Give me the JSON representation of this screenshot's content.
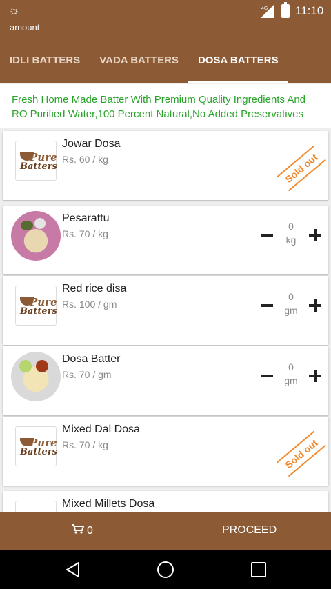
{
  "statusbar": {
    "time": "11:10",
    "network": "4G"
  },
  "appbar": {
    "title": "amount"
  },
  "tabs": [
    {
      "label": "IDLI BATTERS",
      "active": false
    },
    {
      "label": "VADA BATTERS",
      "active": false
    },
    {
      "label": "DOSA BATTERS",
      "active": true
    }
  ],
  "banner": {
    "line1": "Fresh Home Made Batter With Premium Quality Ingredients And",
    "line2": "RO Purified Water,100 Percent Natural,No Added Preservatives"
  },
  "logo": {
    "word1": "Pure",
    "word2": "Batters"
  },
  "products": [
    {
      "name": "Jowar Dosa",
      "price": "Rs.  60  / kg",
      "status": "Sold out",
      "image": "logo"
    },
    {
      "name": "Pesarattu",
      "price": "Rs.  70  / kg",
      "qty": "0",
      "unit": "kg",
      "image": "pesarattu-photo"
    },
    {
      "name": "Red rice disa",
      "price": "Rs.  100  / gm",
      "qty": "0",
      "unit": "gm",
      "image": "logo"
    },
    {
      "name": "Dosa Batter",
      "price": "Rs.  70  / gm",
      "qty": "0",
      "unit": "gm",
      "image": "dosa-photo"
    },
    {
      "name": "Mixed Dal Dosa",
      "price": "Rs.  70  / kg",
      "status": "Sold out",
      "image": "logo"
    },
    {
      "name": "Mixed Millets Dosa",
      "price": "",
      "image": "logo"
    }
  ],
  "bottombar": {
    "cart_count": "0",
    "proceed_label": "PROCEED"
  },
  "colors": {
    "brand": "#8c5a34",
    "banner_text": "#2aa32a",
    "sold_out": "#f08a2c"
  }
}
